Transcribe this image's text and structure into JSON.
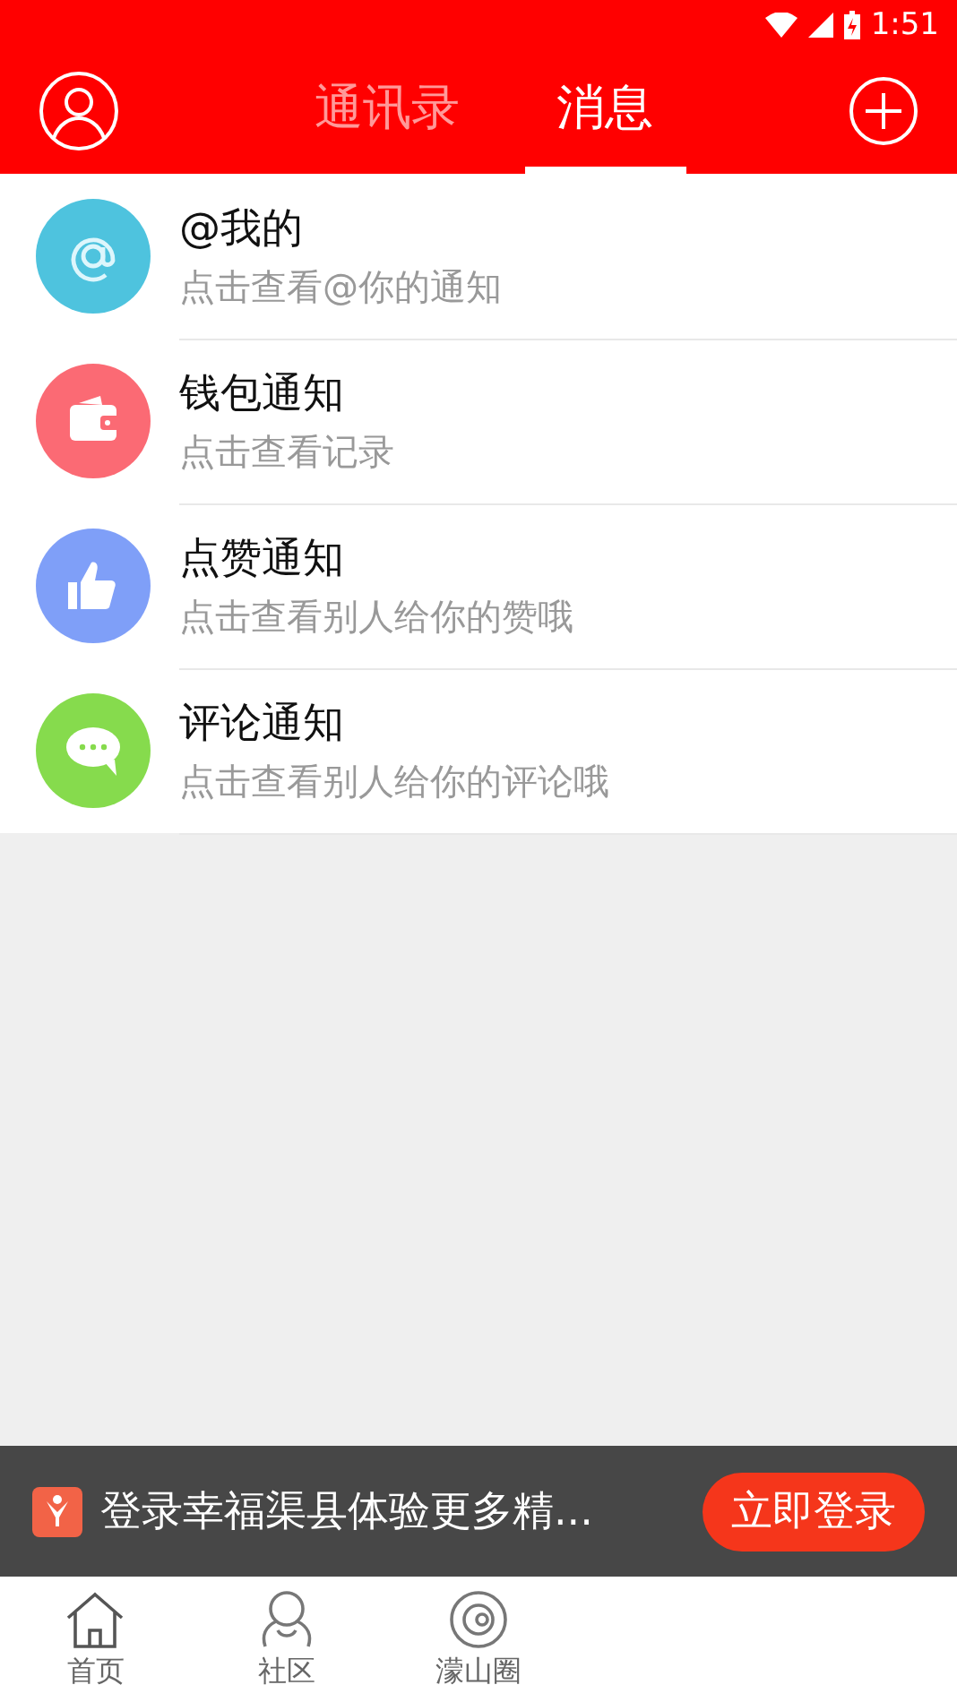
{
  "status_bar": {
    "time": "1:51"
  },
  "header": {
    "tabs": [
      {
        "label": "通讯录",
        "selected": false
      },
      {
        "label": "消息",
        "selected": true
      }
    ]
  },
  "notifications": [
    {
      "kind": "mention",
      "color": "#4ec3de",
      "title": "@我的",
      "subtitle": "点击查看@你的通知"
    },
    {
      "kind": "wallet",
      "color": "#fb6a74",
      "title": "钱包通知",
      "subtitle": "点击查看记录"
    },
    {
      "kind": "like",
      "color": "#7f9ff8",
      "title": "点赞通知",
      "subtitle": "点击查看别人给你的赞哦"
    },
    {
      "kind": "comment",
      "color": "#86db4d",
      "title": "评论通知",
      "subtitle": "点击查看别人给你的评论哦"
    }
  ],
  "login_banner": {
    "text": "登录幸福渠县体验更多精...",
    "button": "立即登录"
  },
  "bottom_nav": [
    {
      "kind": "home",
      "label": "首页"
    },
    {
      "kind": "community",
      "label": "社区"
    },
    {
      "kind": "circle",
      "label": "濛山圈"
    }
  ]
}
